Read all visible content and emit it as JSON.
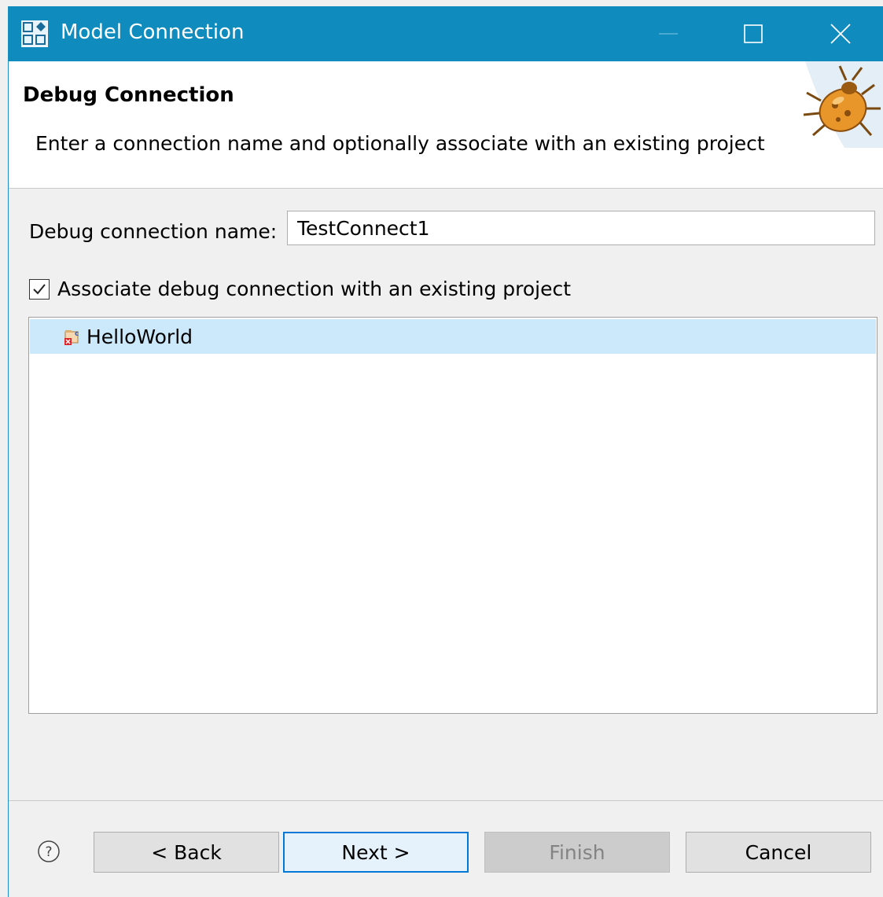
{
  "window": {
    "title": "Model Connection",
    "controls": {
      "minimize": "minimize-icon",
      "maximize": "maximize-icon",
      "close": "close-icon"
    }
  },
  "banner": {
    "title": "Debug Connection",
    "description": "Enter a connection name and optionally associate with an existing project",
    "icon": "bug-icon"
  },
  "form": {
    "name_label": "Debug connection name:",
    "name_value": "TestConnect1",
    "associate_label": "Associate debug connection with an existing project",
    "associate_checked": true
  },
  "projects": [
    {
      "label": "HelloWorld",
      "icon": "c-project-icon",
      "selected": true
    }
  ],
  "buttons": {
    "help_icon": "help-icon",
    "back": "< Back",
    "next": "Next >",
    "finish": "Finish",
    "cancel": "Cancel"
  },
  "colors": {
    "titlebar": "#0f8bbd",
    "selection": "#cce8fb",
    "default_button_border": "#0078d7"
  }
}
